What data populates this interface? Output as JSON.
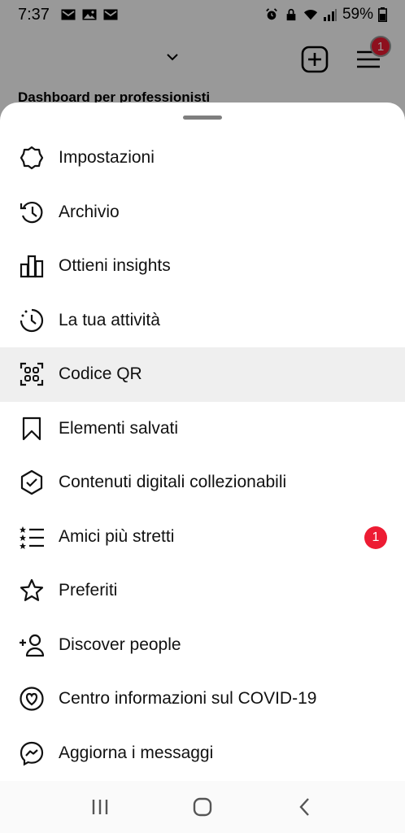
{
  "status_bar": {
    "time": "7:37",
    "battery": "59%",
    "left_icons": [
      "gmail-icon",
      "gallery-icon",
      "mail-icon"
    ],
    "right_icons": [
      "alarm-icon",
      "lock-icon",
      "wifi-icon",
      "signal-icon",
      "battery-icon"
    ]
  },
  "background": {
    "dashboard_label": "Dashboard per professionisti",
    "menu_badge": "1"
  },
  "menu": {
    "items": [
      {
        "label": "Impostazioni",
        "icon": "settings-icon"
      },
      {
        "label": "Archivio",
        "icon": "archive-icon"
      },
      {
        "label": "Ottieni insights",
        "icon": "insights-icon"
      },
      {
        "label": "La tua attività",
        "icon": "activity-icon"
      },
      {
        "label": "Codice QR",
        "icon": "qr-code-icon",
        "active": true
      },
      {
        "label": "Elementi salvati",
        "icon": "bookmark-icon"
      },
      {
        "label": "Contenuti digitali collezionabili",
        "icon": "shield-check-icon"
      },
      {
        "label": "Amici più stretti",
        "icon": "close-friends-icon",
        "badge": "1"
      },
      {
        "label": "Preferiti",
        "icon": "star-icon"
      },
      {
        "label": "Discover people",
        "icon": "add-person-icon"
      },
      {
        "label": "Centro informazioni sul COVID-19",
        "icon": "covid-info-icon"
      },
      {
        "label": "Aggiorna i messaggi",
        "icon": "messenger-icon"
      }
    ]
  },
  "colors": {
    "badge": "#ed1c33",
    "active_row": "#efefef",
    "scrim": "rgba(0,0,0,0.40)"
  }
}
